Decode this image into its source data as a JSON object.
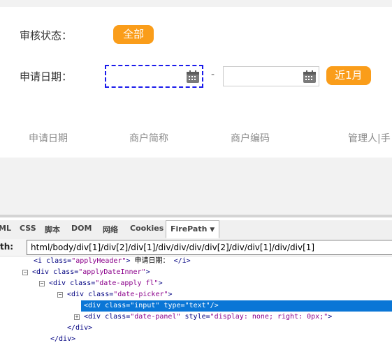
{
  "filters": {
    "status_label": "审核状态：",
    "status_all_button": "全部",
    "apply_date_label": "申请日期：",
    "date_separator": "-",
    "start_date_value": "",
    "end_date_value": "",
    "recent_month_button": "近1月"
  },
  "table": {
    "columns": [
      "申请日期",
      "商户简称",
      "商户编码",
      "管理人|手"
    ]
  },
  "devtools": {
    "tabs": [
      "ML",
      "CSS",
      "脚本",
      "DOM",
      "网络",
      "Cookies",
      "FirePath"
    ],
    "active_tab": "FirePath",
    "active_tab_arrow": "▼",
    "xpath_label": "th:",
    "xpath_value": "html/body/div[1]/div[2]/div[1]/div/div/div/div[2]/div/div[1]/div/div[1]",
    "tree": [
      {
        "toggle": "",
        "tag_open": "<i",
        "attrs": [
          {
            "name": "class",
            "value": "\"applyHeader\""
          }
        ],
        "tag_end": ">",
        "text": "申请日期：",
        "close": "</i>"
      },
      {
        "toggle": "minus",
        "tag_open": "<div",
        "attrs": [
          {
            "name": "class",
            "value": "\"applyDateInner\""
          }
        ],
        "tag_end": ">",
        "text": "",
        "close": ""
      },
      {
        "toggle": "minus",
        "tag_open": "<div",
        "attrs": [
          {
            "name": "class",
            "value": "\"date-apply fl\""
          }
        ],
        "tag_end": ">",
        "text": "",
        "close": ""
      },
      {
        "toggle": "minus",
        "tag_open": "<div",
        "attrs": [
          {
            "name": "class",
            "value": "\"date-picker\""
          }
        ],
        "tag_end": ">",
        "text": "",
        "close": ""
      },
      {
        "toggle": "",
        "tag_open": "<div",
        "attrs": [
          {
            "name": "class",
            "value": "\"input\""
          },
          {
            "name": "type",
            "value": "\"text\""
          }
        ],
        "tag_end": "/>",
        "text": "",
        "close": "",
        "selected": true
      },
      {
        "toggle": "plus",
        "tag_open": "<div",
        "attrs": [
          {
            "name": "class",
            "value": "\"date-panel\""
          },
          {
            "name": "style",
            "value": "\"display: none; right: 0px;\""
          }
        ],
        "tag_end": ">",
        "text": "",
        "close": ""
      },
      {
        "toggle": "",
        "tag_open": "</div>",
        "attrs": [],
        "tag_end": "",
        "text": "",
        "close": ""
      },
      {
        "toggle": "",
        "tag_open": "</div>",
        "attrs": [],
        "tag_end": "",
        "text": "",
        "close": ""
      }
    ]
  },
  "colors": {
    "accent_orange": "#fa9d1a",
    "selection_blue": "#0a76d6",
    "focus_outline": "#1a1aeb"
  },
  "icons": {
    "calendar": "calendar-icon"
  }
}
